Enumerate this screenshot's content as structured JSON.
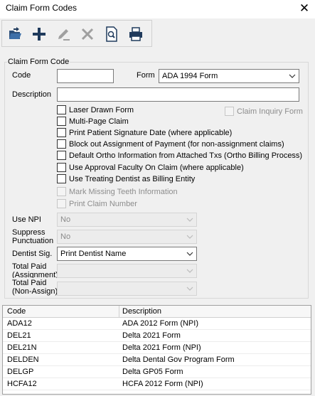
{
  "window": {
    "title": "Claim Form Codes",
    "close_glyph": "✕"
  },
  "toolbar": {
    "buttons": [
      {
        "icon": "open-folder-icon",
        "enabled": true
      },
      {
        "icon": "add-icon",
        "enabled": true
      },
      {
        "icon": "edit-pencil-icon",
        "enabled": false
      },
      {
        "icon": "delete-x-icon",
        "enabled": false
      },
      {
        "icon": "preview-icon",
        "enabled": true
      },
      {
        "icon": "print-icon",
        "enabled": true
      }
    ]
  },
  "form": {
    "group_label": "Claim Form Code",
    "code_label": "Code",
    "code_value": "",
    "form_label": "Form",
    "form_value": "ADA 1994 Form",
    "description_label": "Description",
    "description_value": "",
    "claim_inquiry_label": "Claim Inquiry Form",
    "checkboxes": [
      "Laser Drawn Form",
      "Multi-Page Claim",
      "Print Patient Signature Date (where applicable)",
      "Block out Assignment of Payment (for non-assignment claims)",
      "Default Ortho Information from Attached Txs (Ortho Billing Process)",
      "Use Approval Faculty On Claim (where applicable)",
      "Use Treating Dentist as Billing Entity"
    ],
    "disabled_checkboxes": [
      "Mark Missing Teeth Information",
      "Print Claim Number"
    ],
    "use_npi_label": "Use NPI",
    "use_npi_value": "No",
    "suppress_label_1": "Suppress",
    "suppress_label_2": "Punctuation",
    "suppress_value": "No",
    "dentist_sig_label": "Dentist Sig.",
    "dentist_sig_value": "Print Dentist Name",
    "total_paid_assign_label_1": "Total Paid",
    "total_paid_assign_label_2": "(Assignment)",
    "total_paid_nonassign_label_1": "Total Paid",
    "total_paid_nonassign_label_2": "(Non-Assign)"
  },
  "grid": {
    "columns": [
      "Code",
      "Description"
    ],
    "rows": [
      [
        "ADA12",
        "ADA 2012 Form (NPI)"
      ],
      [
        "DEL21",
        "Delta 2021 Form"
      ],
      [
        "DEL21N",
        "Delta 2021 Form (NPI)"
      ],
      [
        "DELDEN",
        "Delta Dental Gov Program Form"
      ],
      [
        "DELGP",
        "Delta GP05 Form"
      ],
      [
        "HCFA12",
        "HCFA 2012 Form (NPI)"
      ]
    ]
  }
}
